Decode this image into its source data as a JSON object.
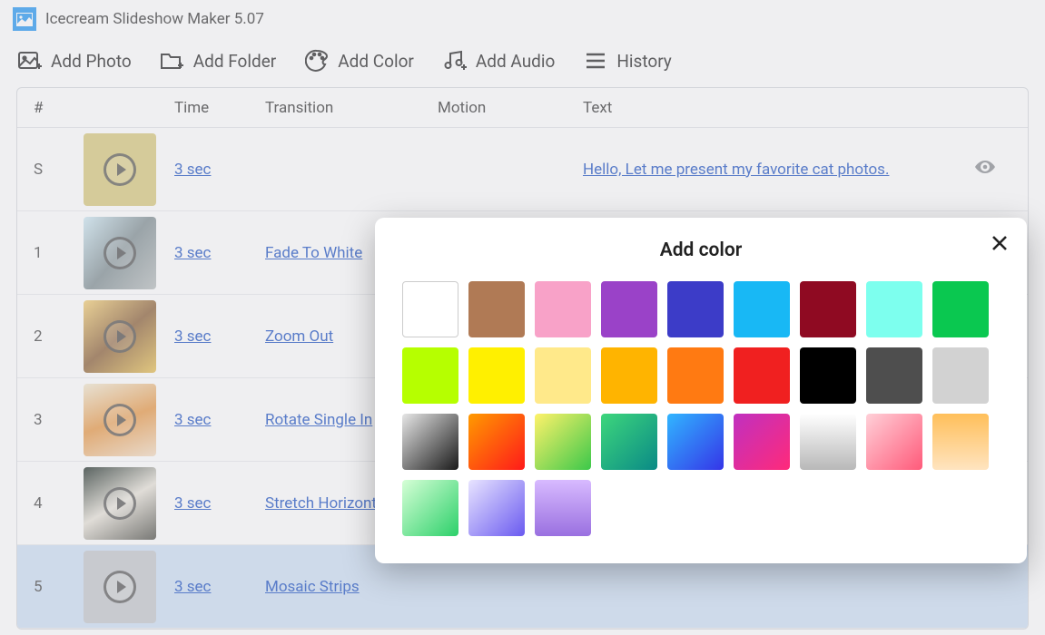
{
  "app": {
    "title": "Icecream Slideshow Maker 5.07"
  },
  "toolbar": {
    "add_photo": "Add Photo",
    "add_folder": "Add Folder",
    "add_color": "Add Color",
    "add_audio": "Add Audio",
    "history": "History"
  },
  "table": {
    "headers": {
      "num": "#",
      "time": "Time",
      "transition": "Transition",
      "motion": "Motion",
      "text": "Text"
    },
    "rows": [
      {
        "num": "S",
        "time": "3 sec",
        "transition": "",
        "motion": "",
        "text": "Hello, Let me present my favorite cat photos.",
        "thumb_bg": "#d8c87a",
        "eye": true
      },
      {
        "num": "1",
        "time": "3 sec",
        "transition": "Fade To White",
        "motion": "",
        "text": "",
        "thumb_bg": "linear-gradient(130deg,#cfeaf5,#7d8c90,#b7bdbd)"
      },
      {
        "num": "2",
        "time": "3 sec",
        "transition": "Zoom Out",
        "motion": "",
        "text": "",
        "thumb_bg": "linear-gradient(140deg,#f5cf72,#8a5e34,#e8c050)"
      },
      {
        "num": "3",
        "time": "3 sec",
        "transition": "Rotate Single In",
        "motion": "",
        "text": "",
        "thumb_bg": "linear-gradient(160deg,#f3e9d0,#e89743,#f5ddc2)"
      },
      {
        "num": "4",
        "time": "3 sec",
        "transition": "Stretch Horizontal",
        "motion": "",
        "text": "",
        "thumb_bg": "linear-gradient(150deg,#1c2a23,#e8e3d8,#4a4a42)"
      },
      {
        "num": "5",
        "time": "3 sec",
        "transition": "Mosaic Strips",
        "motion": "",
        "text": "",
        "thumb_bg": "#c4c7cb",
        "selected": true
      }
    ]
  },
  "modal": {
    "title": "Add color",
    "colors": [
      {
        "name": "white",
        "css": "#ffffff",
        "border": true
      },
      {
        "name": "brown",
        "css": "#b07a55"
      },
      {
        "name": "pink",
        "css": "#f8a2c8"
      },
      {
        "name": "purple",
        "css": "#9a42c8"
      },
      {
        "name": "indigo",
        "css": "#3c3cc8"
      },
      {
        "name": "sky",
        "css": "#18b8f5"
      },
      {
        "name": "maroon",
        "css": "#8f0a22"
      },
      {
        "name": "aqua",
        "css": "#7dffee"
      },
      {
        "name": "green",
        "css": "#0ac850"
      },
      {
        "name": "lime",
        "css": "#b6ff00"
      },
      {
        "name": "yellow",
        "css": "#fff000"
      },
      {
        "name": "cream",
        "css": "#ffe98a"
      },
      {
        "name": "amber",
        "css": "#ffb400"
      },
      {
        "name": "orange",
        "css": "#ff7a12"
      },
      {
        "name": "red",
        "css": "#f02020"
      },
      {
        "name": "black",
        "css": "#000000"
      },
      {
        "name": "dark-gray",
        "css": "#4e4e4e"
      },
      {
        "name": "light-gray",
        "css": "#d2d2d2"
      },
      {
        "name": "grad-gray",
        "css": "linear-gradient(135deg,#e6e6e6,#1a1a1a)"
      },
      {
        "name": "grad-fire",
        "css": "linear-gradient(135deg,#ff9a00,#ff1a1a)"
      },
      {
        "name": "grad-citrus",
        "css": "linear-gradient(135deg,#fff26a,#3cc84a)"
      },
      {
        "name": "grad-forest",
        "css": "linear-gradient(135deg,#3dd67c,#0a8a86)"
      },
      {
        "name": "grad-ocean",
        "css": "linear-gradient(135deg,#31b5ff,#3535e8)"
      },
      {
        "name": "grad-magenta",
        "css": "linear-gradient(135deg,#c030c0,#ff2a7a)"
      },
      {
        "name": "grad-silver",
        "css": "linear-gradient(180deg,#ffffff,#b8b8b8)"
      },
      {
        "name": "grad-blush",
        "css": "linear-gradient(135deg,#ffd0d8,#ff5a7a)"
      },
      {
        "name": "grad-sunset",
        "css": "linear-gradient(180deg,#ffbf5a,#ffe4c0)"
      },
      {
        "name": "grad-mint",
        "css": "linear-gradient(135deg,#d6ffd6,#2cd06a)"
      },
      {
        "name": "grad-lavender",
        "css": "linear-gradient(135deg,#e8e4ff,#6a5af0)"
      },
      {
        "name": "grad-violet",
        "css": "linear-gradient(180deg,#d8baff,#9a70e0)"
      }
    ]
  }
}
